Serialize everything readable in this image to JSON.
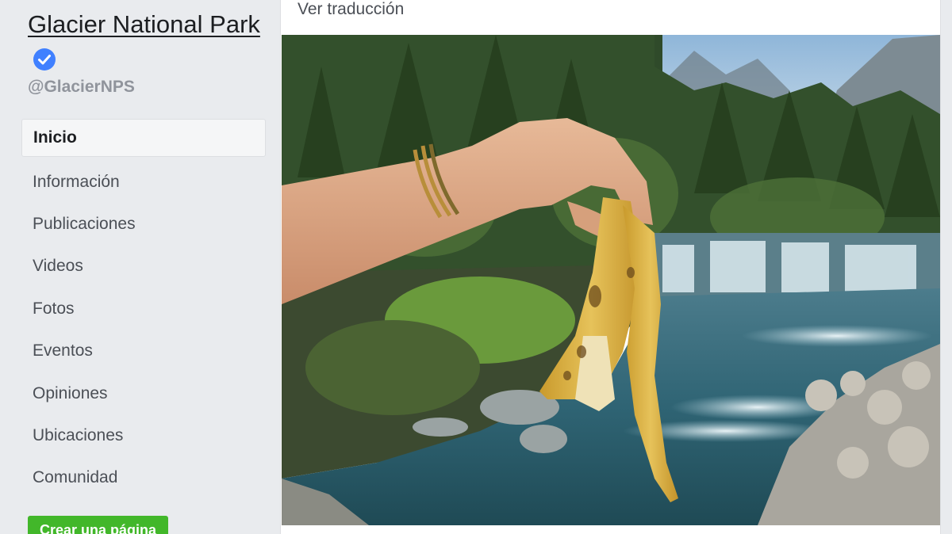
{
  "sidebar": {
    "page_name": "Glacier National Park",
    "handle": "@GlacierNPS",
    "verified_icon": "verified-badge-icon",
    "nav_items": [
      {
        "label": "Inicio",
        "active": true
      },
      {
        "label": "Información",
        "active": false
      },
      {
        "label": "Publicaciones",
        "active": false
      },
      {
        "label": "Videos",
        "active": false
      },
      {
        "label": "Fotos",
        "active": false
      },
      {
        "label": "Eventos",
        "active": false
      },
      {
        "label": "Opiniones",
        "active": false
      },
      {
        "label": "Ubicaciones",
        "active": false
      },
      {
        "label": "Comunidad",
        "active": false
      }
    ],
    "create_page_label": "Crear una página"
  },
  "post": {
    "translate_label": "Ver traducción",
    "photo": "hand holding banana peel in front of river and forest"
  },
  "colors": {
    "background": "#e9ebee",
    "verified_blue": "#4080ff",
    "create_green": "#42b72a",
    "muted_text": "#90949c"
  }
}
